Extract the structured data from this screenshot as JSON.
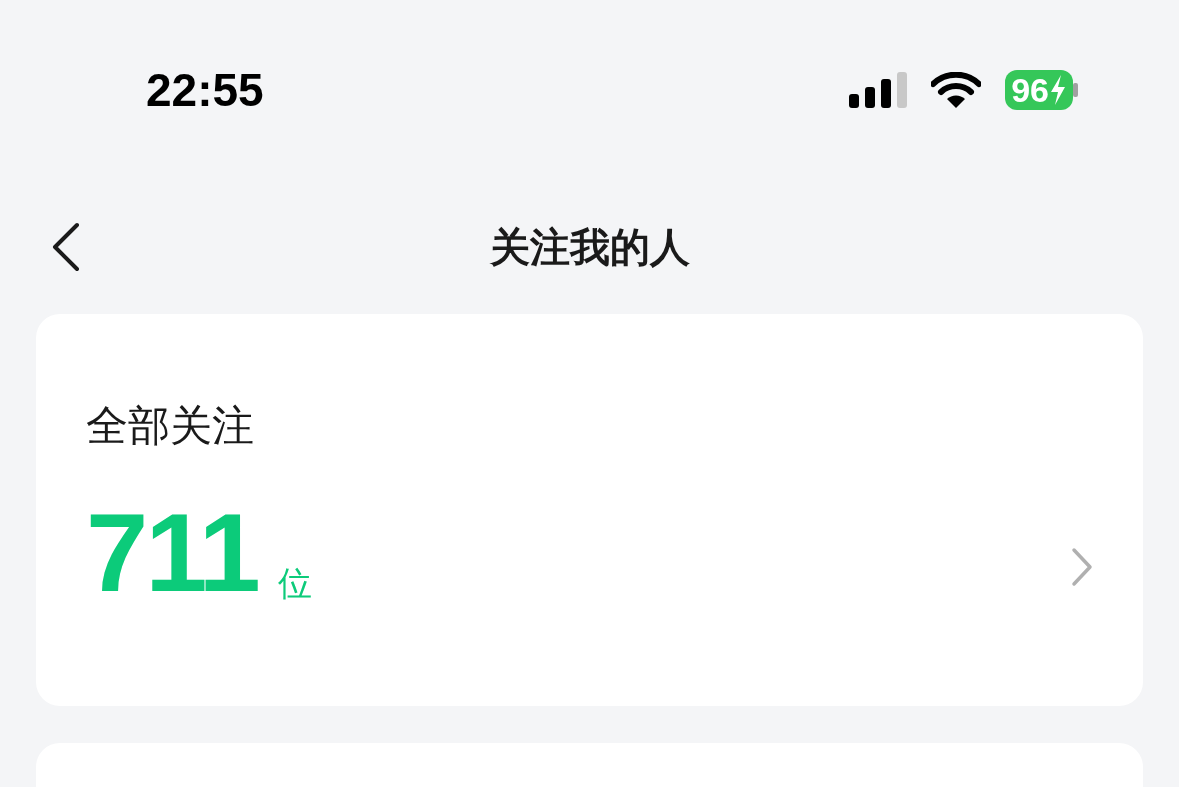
{
  "status_bar": {
    "time": "22:55",
    "battery": {
      "text": "96",
      "charging": true
    }
  },
  "header": {
    "title": "关注我的人"
  },
  "cards": [
    {
      "label": "全部关注",
      "count": "711",
      "unit": "位"
    }
  ]
}
